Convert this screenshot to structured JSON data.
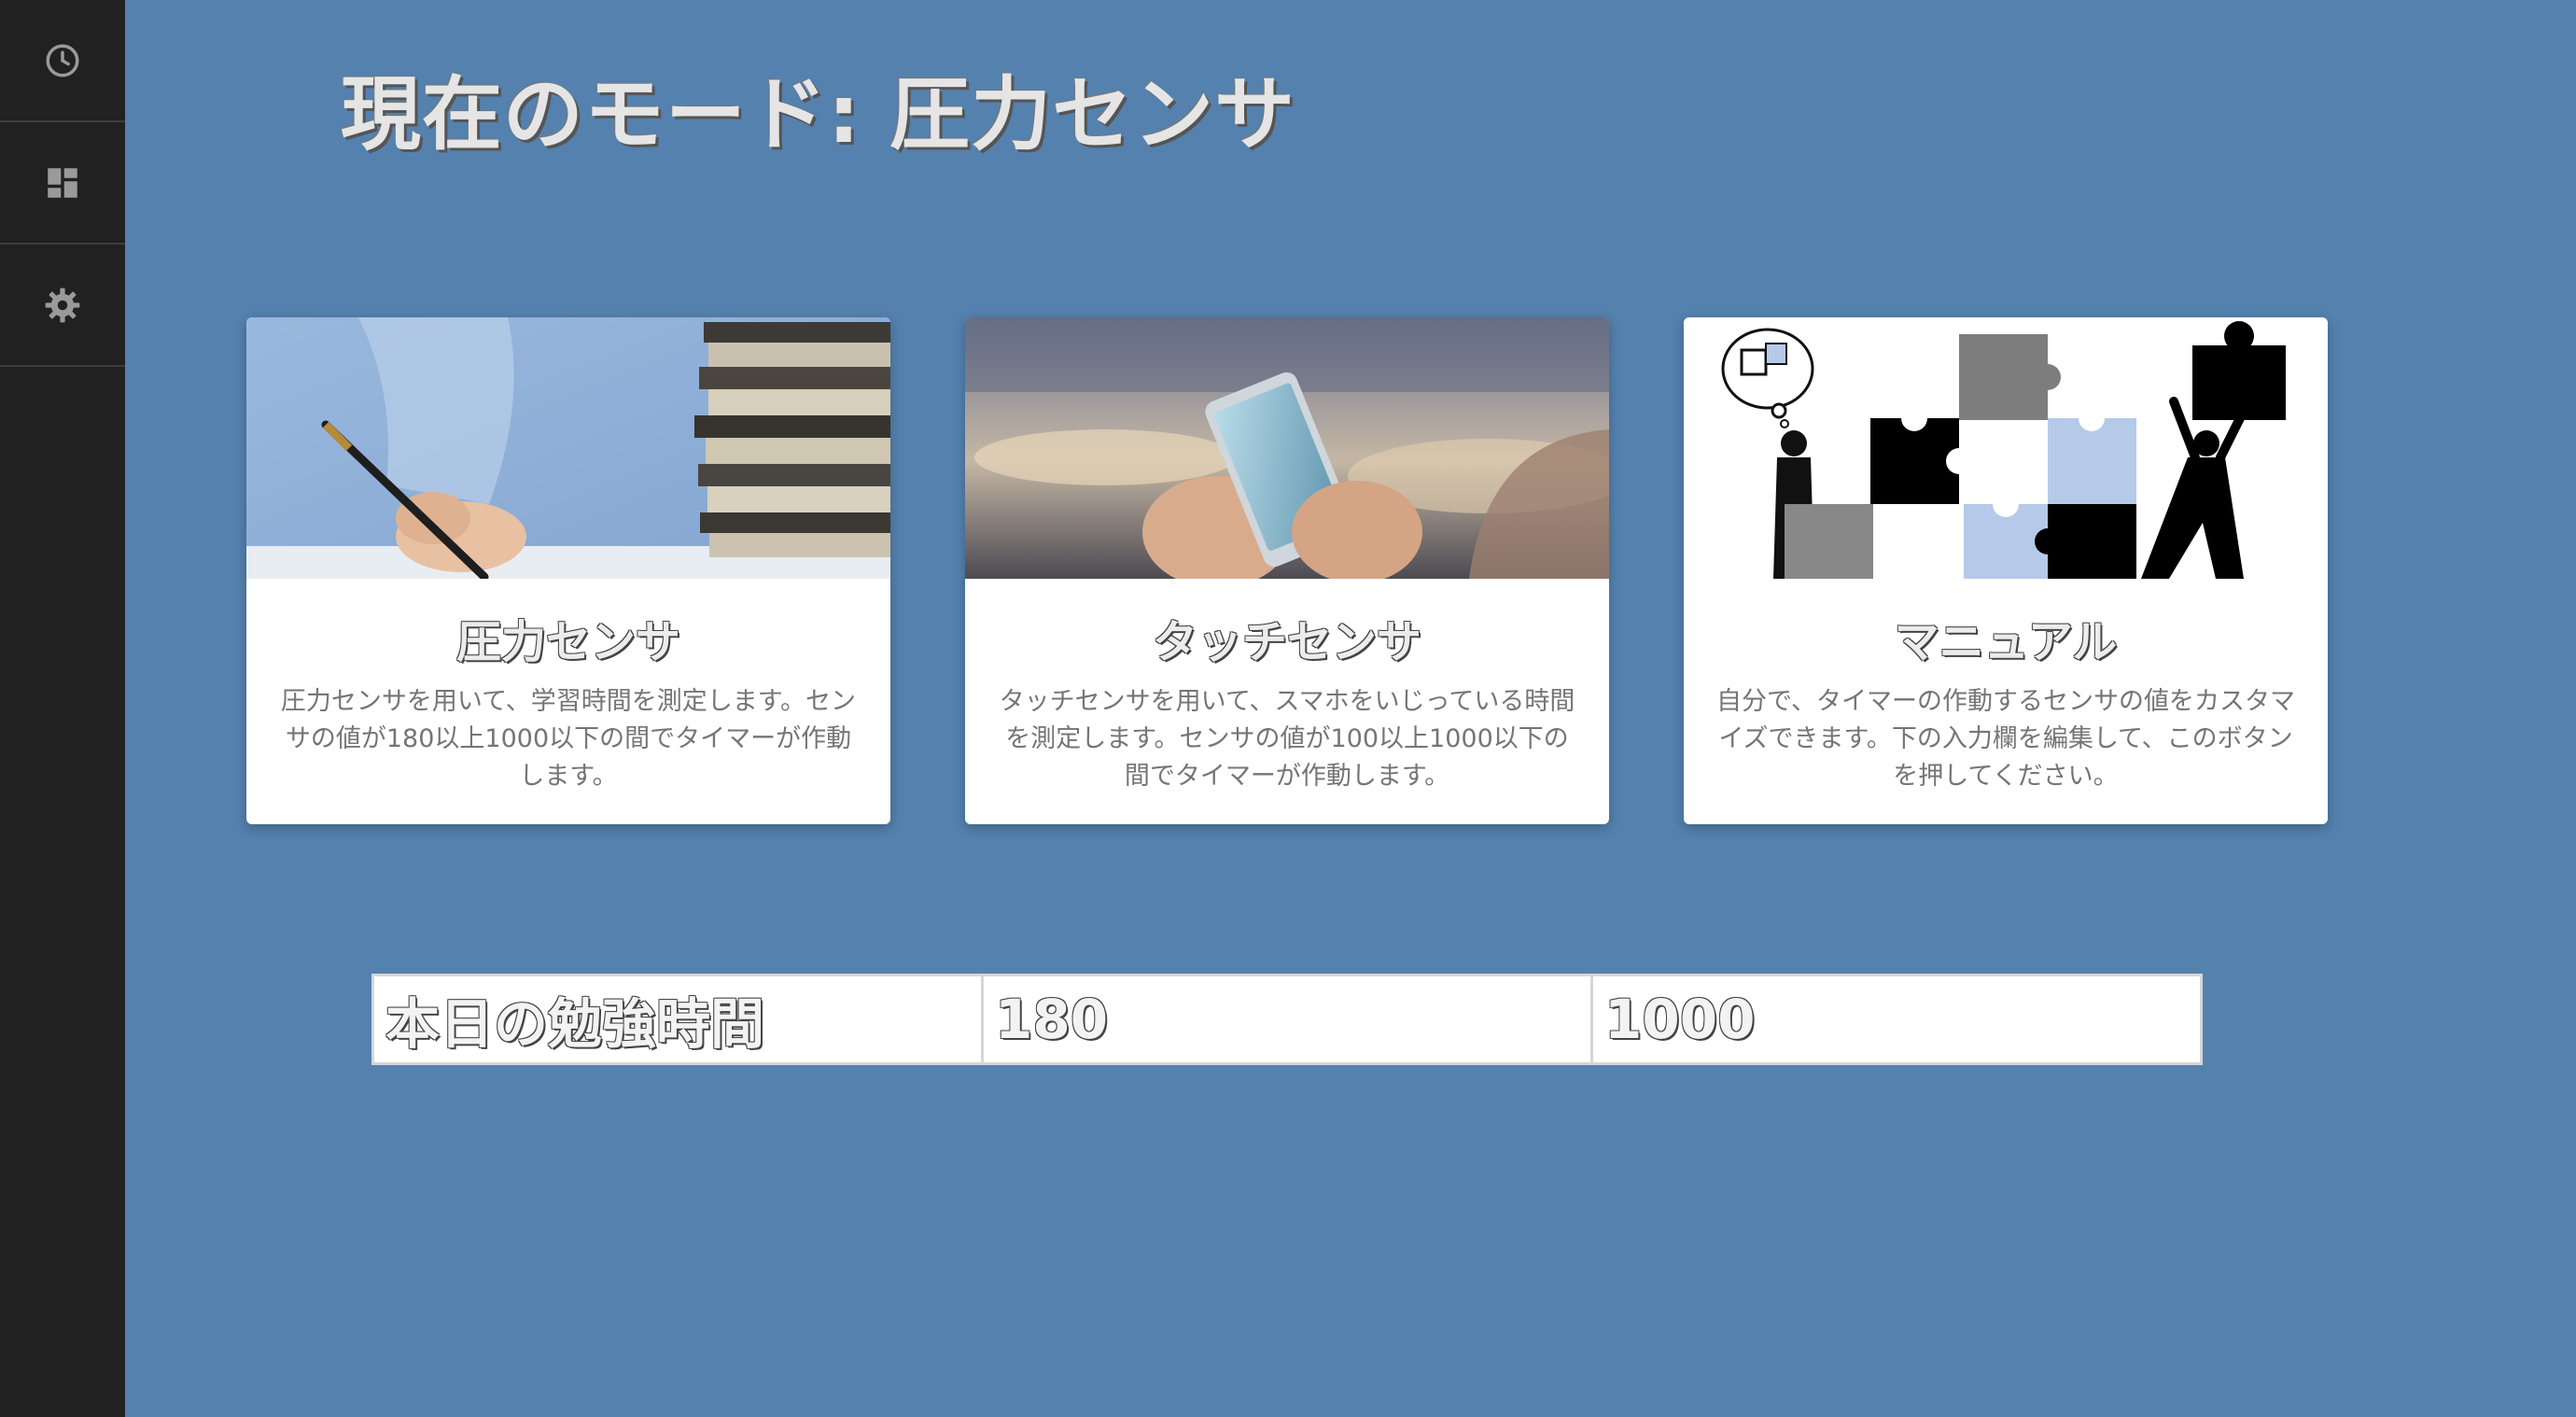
{
  "sidebar": {
    "items": [
      {
        "icon": "clock-icon"
      },
      {
        "icon": "dashboard-icon"
      },
      {
        "icon": "gear-icon"
      }
    ]
  },
  "header": {
    "title": "現在のモード: 圧力センサ"
  },
  "cards": [
    {
      "title": "圧力センサ",
      "description": "圧力センサを用いて、学習時間を測定します。センサの値が180以上1000以下の間でタイマーが作動します。"
    },
    {
      "title": "タッチセンサ",
      "description": "タッチセンサを用いて、スマホをいじっている時間を測定します。センサの値が100以上1000以下の間でタイマーが作動します。"
    },
    {
      "title": "マニュアル",
      "description": "自分で、タイマーの作動するセンサの値をカスタマイズできます。下の入力欄を編集して、このボタンを押してください。"
    }
  ],
  "table": {
    "label": "本日の勉強時間",
    "min_value": "180",
    "max_value": "1000"
  },
  "colors": {
    "background": "#5481ae",
    "sidebar": "#212121",
    "card": "#ffffff"
  }
}
